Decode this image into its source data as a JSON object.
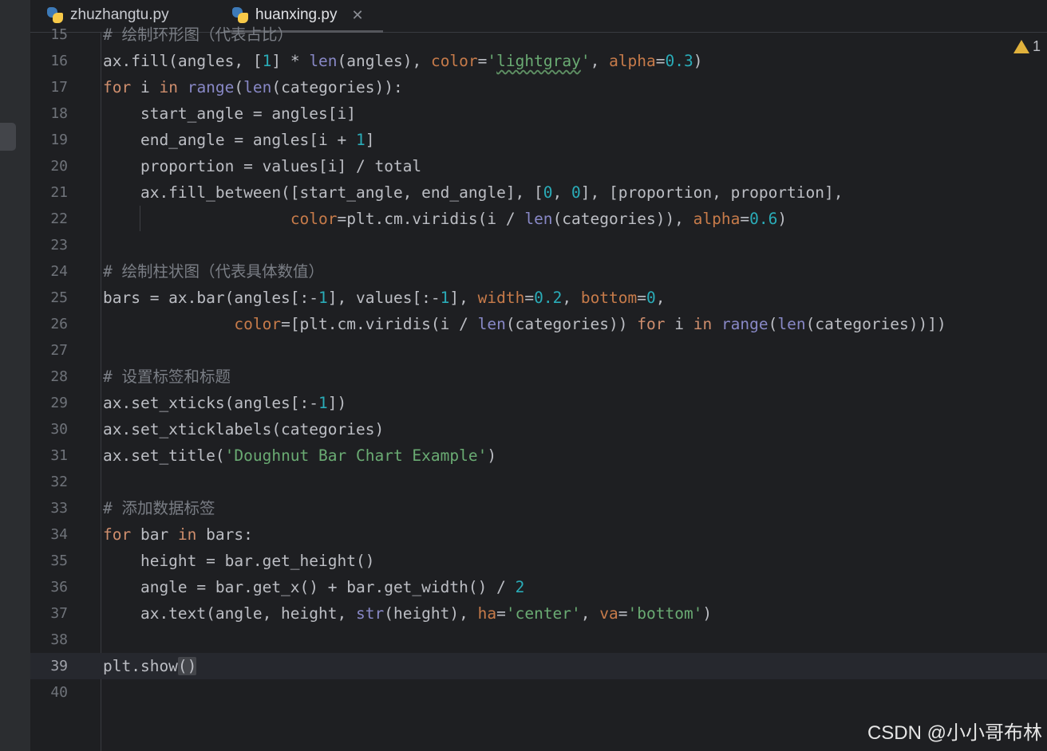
{
  "tabs": [
    {
      "label": "zhuzhangtu.py",
      "active": false
    },
    {
      "label": "huanxing.py",
      "active": true
    }
  ],
  "close_glyph": "✕",
  "warning_count": "1",
  "watermark": "CSDN @小小哥布林",
  "lines": [
    {
      "n": "15",
      "tokens": [
        {
          "t": "# 绘制环形图（代表占比）",
          "c": "cm"
        }
      ]
    },
    {
      "n": "16",
      "tokens": [
        {
          "t": "ax.fill(angles, ["
        },
        {
          "t": "1",
          "c": "num"
        },
        {
          "t": "] * "
        },
        {
          "t": "len",
          "c": "bi"
        },
        {
          "t": "(angles), "
        },
        {
          "t": "color",
          "c": "param"
        },
        {
          "t": "="
        },
        {
          "t": "'",
          "c": "str"
        },
        {
          "t": "lightgray",
          "c": "str wavy"
        },
        {
          "t": "'",
          "c": "str"
        },
        {
          "t": ", "
        },
        {
          "t": "alpha",
          "c": "param"
        },
        {
          "t": "="
        },
        {
          "t": "0.3",
          "c": "num"
        },
        {
          "t": ")"
        }
      ]
    },
    {
      "n": "17",
      "tokens": [
        {
          "t": "for",
          "c": "kw"
        },
        {
          "t": " i "
        },
        {
          "t": "in",
          "c": "kw"
        },
        {
          "t": " "
        },
        {
          "t": "range",
          "c": "bi"
        },
        {
          "t": "("
        },
        {
          "t": "len",
          "c": "bi"
        },
        {
          "t": "(categories)):"
        }
      ]
    },
    {
      "n": "18",
      "tokens": [
        {
          "t": "    start_angle = angles[i]"
        }
      ]
    },
    {
      "n": "19",
      "tokens": [
        {
          "t": "    end_angle = angles[i + "
        },
        {
          "t": "1",
          "c": "num"
        },
        {
          "t": "]"
        }
      ]
    },
    {
      "n": "20",
      "tokens": [
        {
          "t": "    proportion = values[i] / total"
        }
      ]
    },
    {
      "n": "21",
      "tokens": [
        {
          "t": "    ax.fill_between([start_angle, end_angle], ["
        },
        {
          "t": "0",
          "c": "num"
        },
        {
          "t": ", "
        },
        {
          "t": "0",
          "c": "num"
        },
        {
          "t": "], [proportion, proportion],"
        }
      ]
    },
    {
      "n": "22",
      "tokens": [
        {
          "t": "                    "
        },
        {
          "t": "color",
          "c": "param"
        },
        {
          "t": "=plt.cm.viridis(i / "
        },
        {
          "t": "len",
          "c": "bi"
        },
        {
          "t": "(categories)), "
        },
        {
          "t": "alpha",
          "c": "param"
        },
        {
          "t": "="
        },
        {
          "t": "0.6",
          "c": "num"
        },
        {
          "t": ")"
        }
      ]
    },
    {
      "n": "23",
      "tokens": []
    },
    {
      "n": "24",
      "tokens": [
        {
          "t": "# 绘制柱状图（代表具体数值）",
          "c": "cm"
        }
      ]
    },
    {
      "n": "25",
      "tokens": [
        {
          "t": "bars = ax.bar(angles[:-"
        },
        {
          "t": "1",
          "c": "num"
        },
        {
          "t": "], values[:-"
        },
        {
          "t": "1",
          "c": "num"
        },
        {
          "t": "], "
        },
        {
          "t": "width",
          "c": "param"
        },
        {
          "t": "="
        },
        {
          "t": "0.2",
          "c": "num"
        },
        {
          "t": ", "
        },
        {
          "t": "bottom",
          "c": "param"
        },
        {
          "t": "="
        },
        {
          "t": "0",
          "c": "num"
        },
        {
          "t": ","
        }
      ]
    },
    {
      "n": "26",
      "tokens": [
        {
          "t": "              "
        },
        {
          "t": "color",
          "c": "param"
        },
        {
          "t": "=[plt.cm.viridis(i / "
        },
        {
          "t": "len",
          "c": "bi"
        },
        {
          "t": "(categories)) "
        },
        {
          "t": "for",
          "c": "kw"
        },
        {
          "t": " i "
        },
        {
          "t": "in",
          "c": "kw"
        },
        {
          "t": " "
        },
        {
          "t": "range",
          "c": "bi"
        },
        {
          "t": "("
        },
        {
          "t": "len",
          "c": "bi"
        },
        {
          "t": "(categories))])"
        }
      ]
    },
    {
      "n": "27",
      "tokens": []
    },
    {
      "n": "28",
      "tokens": [
        {
          "t": "# 设置标签和标题",
          "c": "cm"
        }
      ]
    },
    {
      "n": "29",
      "tokens": [
        {
          "t": "ax.set_xticks(angles[:-"
        },
        {
          "t": "1",
          "c": "num"
        },
        {
          "t": "])"
        }
      ]
    },
    {
      "n": "30",
      "tokens": [
        {
          "t": "ax.set_xticklabels(categories)"
        }
      ]
    },
    {
      "n": "31",
      "tokens": [
        {
          "t": "ax.set_title("
        },
        {
          "t": "'Doughnut Bar Chart Example'",
          "c": "str"
        },
        {
          "t": ")"
        }
      ]
    },
    {
      "n": "32",
      "tokens": []
    },
    {
      "n": "33",
      "tokens": [
        {
          "t": "# 添加数据标签",
          "c": "cm"
        }
      ]
    },
    {
      "n": "34",
      "tokens": [
        {
          "t": "for",
          "c": "kw"
        },
        {
          "t": " bar "
        },
        {
          "t": "in",
          "c": "kw"
        },
        {
          "t": " bars:"
        }
      ]
    },
    {
      "n": "35",
      "tokens": [
        {
          "t": "    height = bar.get_height()"
        }
      ]
    },
    {
      "n": "36",
      "tokens": [
        {
          "t": "    angle = bar.get_x() + bar.get_width() / "
        },
        {
          "t": "2",
          "c": "num"
        }
      ]
    },
    {
      "n": "37",
      "tokens": [
        {
          "t": "    ax.text(angle, height, "
        },
        {
          "t": "str",
          "c": "bi"
        },
        {
          "t": "(height), "
        },
        {
          "t": "ha",
          "c": "param"
        },
        {
          "t": "="
        },
        {
          "t": "'center'",
          "c": "str"
        },
        {
          "t": ", "
        },
        {
          "t": "va",
          "c": "param"
        },
        {
          "t": "="
        },
        {
          "t": "'bottom'",
          "c": "str"
        },
        {
          "t": ")"
        }
      ]
    },
    {
      "n": "38",
      "tokens": []
    },
    {
      "n": "39",
      "current": true,
      "tokens": [
        {
          "t": "plt.show"
        },
        {
          "t": "()",
          "c": "bracket-hl"
        }
      ]
    },
    {
      "n": "40",
      "tokens": []
    }
  ]
}
